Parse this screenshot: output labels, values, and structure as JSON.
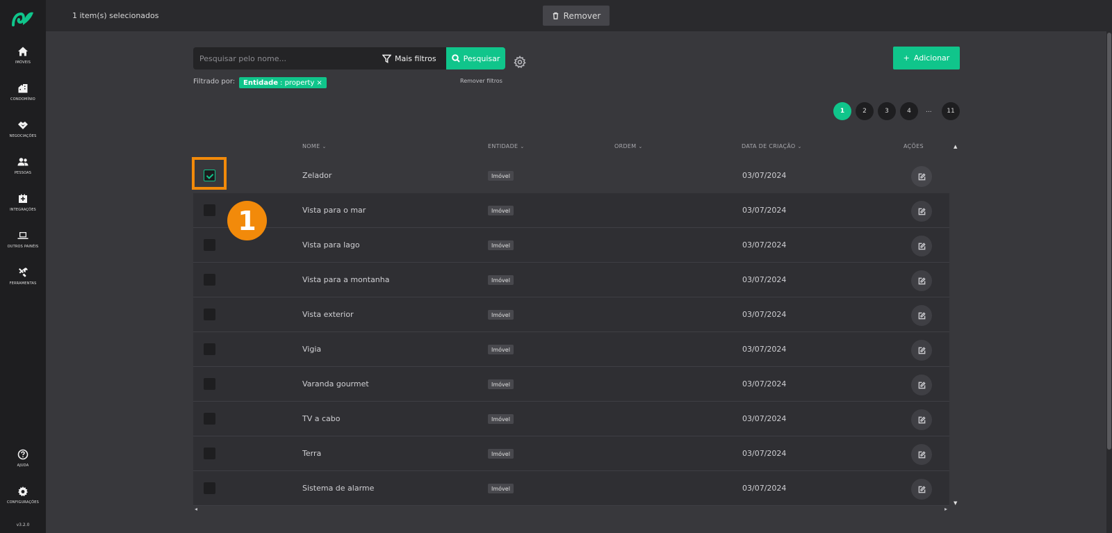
{
  "sidebar": {
    "items": [
      {
        "label": "Imóveis",
        "icon": "home-icon"
      },
      {
        "label": "Condomínio",
        "icon": "building-icon"
      },
      {
        "label": "Negociações",
        "icon": "handshake-icon"
      },
      {
        "label": "Pessoas",
        "icon": "people-icon"
      },
      {
        "label": "Integrações",
        "icon": "plug-icon"
      },
      {
        "label": "Outros painéis",
        "icon": "laptop-icon"
      },
      {
        "label": "Ferramentas",
        "icon": "tools-icon"
      }
    ],
    "bottom": [
      {
        "label": "Ajuda",
        "icon": "help-icon"
      },
      {
        "label": "Configurações",
        "icon": "gear-icon"
      }
    ],
    "version": "v3.2.0"
  },
  "topbar": {
    "selected_text": "1 item(s) selecionados",
    "remove_label": "Remover"
  },
  "search": {
    "placeholder": "Pesquisar pelo nome...",
    "value": "",
    "more_filters_label": "Mais filtros",
    "search_label": "Pesquisar"
  },
  "filters": {
    "filtered_by_label": "Filtrado por:",
    "chip_key": "Entidade",
    "chip_value": ": property",
    "chip_close": "×",
    "remove_filters_label": "Remover filtros"
  },
  "add_button": {
    "label": "Adicionar",
    "icon": "plus-icon"
  },
  "pagination": {
    "pages": [
      "1",
      "2",
      "3",
      "4"
    ],
    "ellipsis": "...",
    "last": "11",
    "active": "1"
  },
  "table": {
    "headers": {
      "name": "NOME",
      "entity": "ENTIDADE",
      "order": "ORDEM",
      "created": "DATA DE CRIAÇÃO",
      "actions": "AÇÕES"
    },
    "rows": [
      {
        "name": "Zelador",
        "entity": "Imóvel",
        "order": "",
        "created": "03/07/2024",
        "selected": true
      },
      {
        "name": "Vista para o mar",
        "entity": "Imóvel",
        "order": "",
        "created": "03/07/2024",
        "selected": false
      },
      {
        "name": "Vista para lago",
        "entity": "Imóvel",
        "order": "",
        "created": "03/07/2024",
        "selected": false
      },
      {
        "name": "Vista para a montanha",
        "entity": "Imóvel",
        "order": "",
        "created": "03/07/2024",
        "selected": false
      },
      {
        "name": "Vista exterior",
        "entity": "Imóvel",
        "order": "",
        "created": "03/07/2024",
        "selected": false
      },
      {
        "name": "Vigia",
        "entity": "Imóvel",
        "order": "",
        "created": "03/07/2024",
        "selected": false
      },
      {
        "name": "Varanda gourmet",
        "entity": "Imóvel",
        "order": "",
        "created": "03/07/2024",
        "selected": false
      },
      {
        "name": "TV a cabo",
        "entity": "Imóvel",
        "order": "",
        "created": "03/07/2024",
        "selected": false
      },
      {
        "name": "Terra",
        "entity": "Imóvel",
        "order": "",
        "created": "03/07/2024",
        "selected": false
      },
      {
        "name": "Sistema de alarme",
        "entity": "Imóvel",
        "order": "",
        "created": "03/07/2024",
        "selected": false
      }
    ]
  },
  "annotation": {
    "step": "1"
  },
  "colors": {
    "accent": "#10c58b",
    "highlight": "#f28a0a",
    "sidebar": "#1e1e20",
    "background": "#38383c"
  }
}
